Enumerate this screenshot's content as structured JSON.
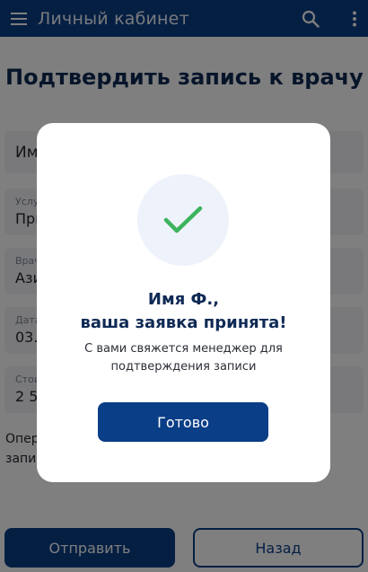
{
  "appbar": {
    "title": "Личный кабинет",
    "background": "#0a3e86",
    "icons": [
      "menu-icon",
      "search-icon",
      "more-vertical-icon"
    ]
  },
  "page": {
    "title": "Подтвердить запись к врачу",
    "fields": [
      {
        "label": "",
        "value": "Им"
      },
      {
        "label": "Услу",
        "value": "При"
      },
      {
        "label": "Врач",
        "value": "Ази"
      },
      {
        "label": "Дата",
        "value": "03.0"
      },
      {
        "label": "Стои",
        "value": "2 50"
      }
    ],
    "note_line1": "Опер",
    "note_line2": "запи",
    "send_label": "Отправить",
    "back_label": "Назад"
  },
  "dialog": {
    "icon": "check-icon",
    "accent": "#3cb45e",
    "title_line1": "Имя Ф.,",
    "title_line2": "ваша заявка принята!",
    "text_line1": "С вами свяжется менеджер для",
    "text_line2": "подтверждения записи",
    "done_label": "Готово"
  }
}
